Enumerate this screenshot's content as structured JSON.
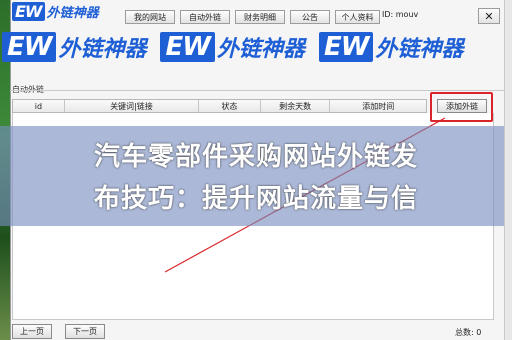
{
  "top_logo": {
    "mark": "EW",
    "text": "外链神器"
  },
  "menu": [
    {
      "label": "我的网站"
    },
    {
      "label": "自动外链"
    },
    {
      "label": "财务明细"
    },
    {
      "label": "公告"
    },
    {
      "label": "个人资料"
    }
  ],
  "user_id_text": "ID: mouv",
  "close_label": "✕",
  "banner_logos": [
    {
      "mark": "EW",
      "text": "外链神器"
    },
    {
      "mark": "EW",
      "text": "外链神器"
    },
    {
      "mark": "EW",
      "text": "外链神器"
    }
  ],
  "section_title": "自动外链",
  "table": {
    "columns": [
      "id",
      "关键词|链接",
      "状态",
      "剩余天数",
      "添加时间"
    ]
  },
  "add_button_label": "添加外链",
  "overlay_title": {
    "line1": "汽车零部件采购网站外链发",
    "line2": "布技巧：提升网站流量与信"
  },
  "pager": {
    "prev": "上一页",
    "next": "下一页",
    "total": "总数: 0"
  }
}
